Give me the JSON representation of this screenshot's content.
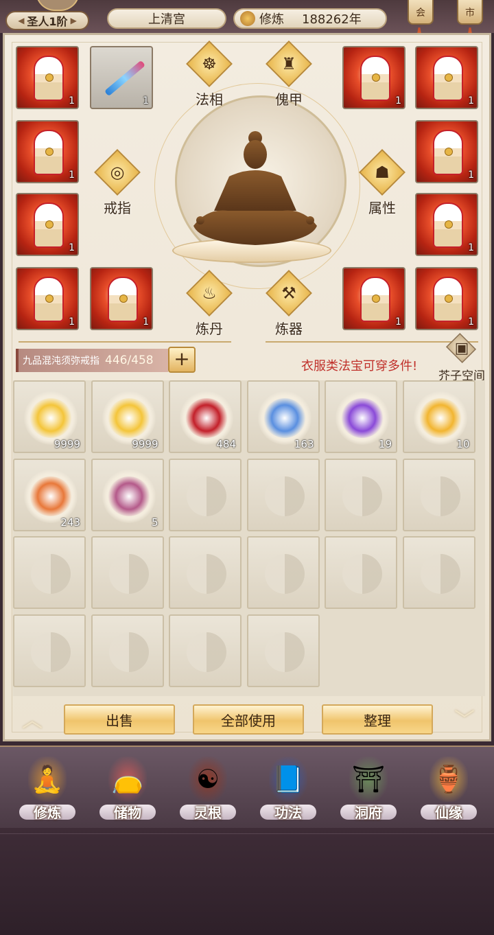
{
  "top": {
    "rank": "圣人1阶",
    "place": "上清宫",
    "cultivation_label": "修炼",
    "cultivation_value": "188262年",
    "tab_right_1": "会",
    "tab_right_2": "市"
  },
  "equipment": {
    "slot_count": "1",
    "func": {
      "faxiang": "法相",
      "kuijia": "傀甲",
      "jiezhi": "戒指",
      "shuxing": "属性",
      "liandan": "炼丹",
      "lianqi": "炼器"
    }
  },
  "ring": {
    "name": "九品混沌须弥戒指",
    "capacity": "446/458",
    "add_label": "+",
    "notice": "衣服类法宝可穿多件!",
    "space_label": "芥子空间"
  },
  "inventory": {
    "items": [
      {
        "count": "9999",
        "color": "#f4c53a"
      },
      {
        "count": "9999",
        "color": "#f4c53a"
      },
      {
        "count": "484",
        "color": "#c3202a"
      },
      {
        "count": "163",
        "color": "#5a8fe0"
      },
      {
        "count": "19",
        "color": "#8a4ad8"
      },
      {
        "count": "10",
        "color": "#f2b530"
      },
      {
        "count": "243",
        "color": "#e8783a"
      },
      {
        "count": "5",
        "color": "#b45a8a"
      }
    ],
    "empty_slots": 14
  },
  "actions": {
    "sell": "出售",
    "use_all": "全部使用",
    "sort": "整理"
  },
  "nav": {
    "items": [
      {
        "label": "修炼",
        "icon": "hooded-monk-icon"
      },
      {
        "label": "储物",
        "icon": "treasure-bag-icon"
      },
      {
        "label": "灵根",
        "icon": "spirit-root-icon"
      },
      {
        "label": "功法",
        "icon": "scripture-book-icon"
      },
      {
        "label": "洞府",
        "icon": "cave-mansion-icon"
      },
      {
        "label": "仙缘",
        "icon": "gourd-icon"
      }
    ]
  },
  "colors": {
    "accent_gold": "#e8b64c",
    "notice_red": "#c0302a",
    "panel_bg": "#f3ece0"
  }
}
